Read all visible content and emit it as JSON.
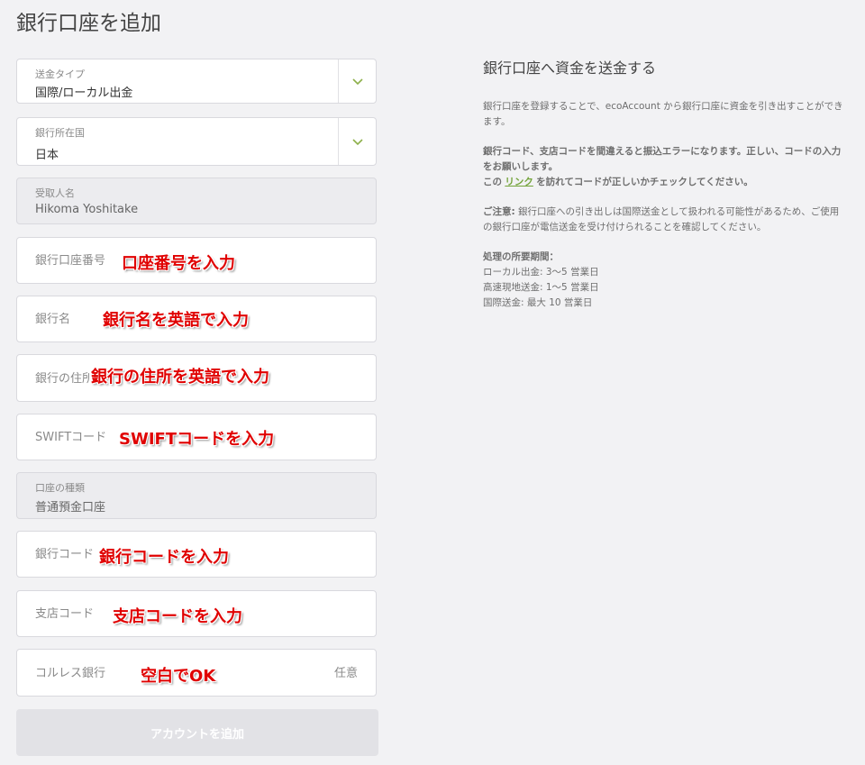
{
  "page_title": "銀行口座を追加",
  "form": {
    "transfer_type": {
      "label": "送金タイプ",
      "value": "国際/ローカル出金"
    },
    "bank_country": {
      "label": "銀行所在国",
      "value": "日本"
    },
    "recipient": {
      "label": "受取人名",
      "value": "Hikoma Yoshitake"
    },
    "account_number": {
      "placeholder": "銀行口座番号",
      "annotation": "口座番号を入力"
    },
    "bank_name": {
      "placeholder": "銀行名",
      "annotation": "銀行名を英語で入力"
    },
    "bank_address": {
      "placeholder": "銀行の住所",
      "annotation": "銀行の住所を英語で入力"
    },
    "swift": {
      "placeholder": "SWIFTコード",
      "annotation": "SWIFTコードを入力"
    },
    "account_type": {
      "label": "口座の種類",
      "value": "普通預金口座"
    },
    "bank_code": {
      "placeholder": "銀行コード",
      "annotation": "銀行コードを入力"
    },
    "branch_code": {
      "placeholder": "支店コード",
      "annotation": "支店コードを入力"
    },
    "corres_bank": {
      "placeholder": "コルレス銀行",
      "optional": "任意",
      "annotation": "空白でOK"
    },
    "submit_label": "アカウントを追加"
  },
  "info": {
    "title": "銀行口座へ資金を送金する",
    "p1": "銀行口座を登録することで、ecoAccount から銀行口座に資金を引き出すことができます。",
    "p2_bold": "銀行コード、支店コードを間違えると振込エラーになります。正しい、コードの入力をお願いします。",
    "p2_line2_prefix": "この",
    "p2_link": "リンク",
    "p2_line2_suffix": "を訪れてコードが正しいかチェックしてください。",
    "p3_bold": "ご注意:",
    "p3_text": "銀行口座への引き出しは国際送金として扱われる可能性があるため、ご使用の銀行口座が電信送金を受け付けられることを確認してください。",
    "p4_title": "処理の所要期間：",
    "p4_lines": [
      "ローカル出金: 3〜5 営業日",
      "高速現地送金: 1〜5 営業日",
      "国際送金: 最大 10 営業日"
    ]
  },
  "colors": {
    "accent": "#8db04a",
    "annotation": "#e00000",
    "link": "#73a33a"
  }
}
